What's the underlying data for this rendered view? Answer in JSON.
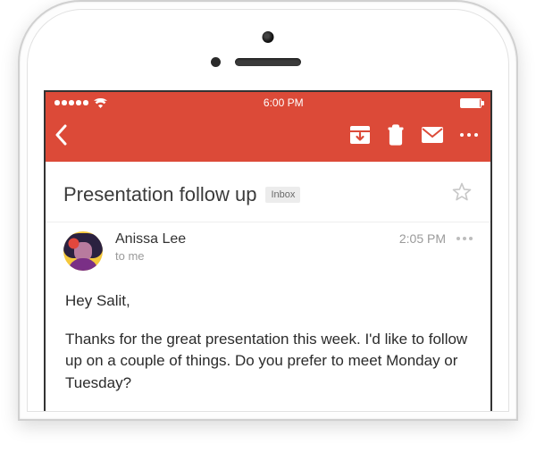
{
  "statusbar": {
    "time": "6:00 PM"
  },
  "email": {
    "subject": "Presentation follow up",
    "label": "Inbox",
    "sender_name": "Anissa Lee",
    "recipient_line": "to me",
    "time": "2:05 PM",
    "body_greeting": "Hey Salit,",
    "body_paragraph": "Thanks for the great presentation this week. I'd like to follow up on a couple of things. Do you prefer to meet Monday or Tuesday?"
  }
}
